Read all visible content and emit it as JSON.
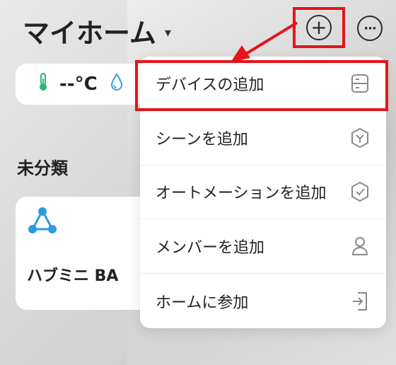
{
  "header": {
    "title": "マイホーム",
    "caret": "▾"
  },
  "toolbar": {
    "add_symbol": "+",
    "more_symbol": "···"
  },
  "weather": {
    "temperature": "--°C"
  },
  "section": {
    "label": "未分類"
  },
  "device": {
    "name": "ハブミニ BA",
    "icon": "hub-icon"
  },
  "menu": {
    "items": [
      {
        "label": "デバイスの追加",
        "icon": "device-icon"
      },
      {
        "label": "シーンを追加",
        "icon": "scene-icon"
      },
      {
        "label": "オートメーションを追加",
        "icon": "automation-icon"
      },
      {
        "label": "メンバーを追加",
        "icon": "member-icon"
      },
      {
        "label": "ホームに参加",
        "icon": "join-home-icon"
      }
    ]
  },
  "colors": {
    "highlight": "#e4141b",
    "thermo": "#2bb673",
    "humidity": "#3aa0e6",
    "hub": "#2e9be0"
  }
}
